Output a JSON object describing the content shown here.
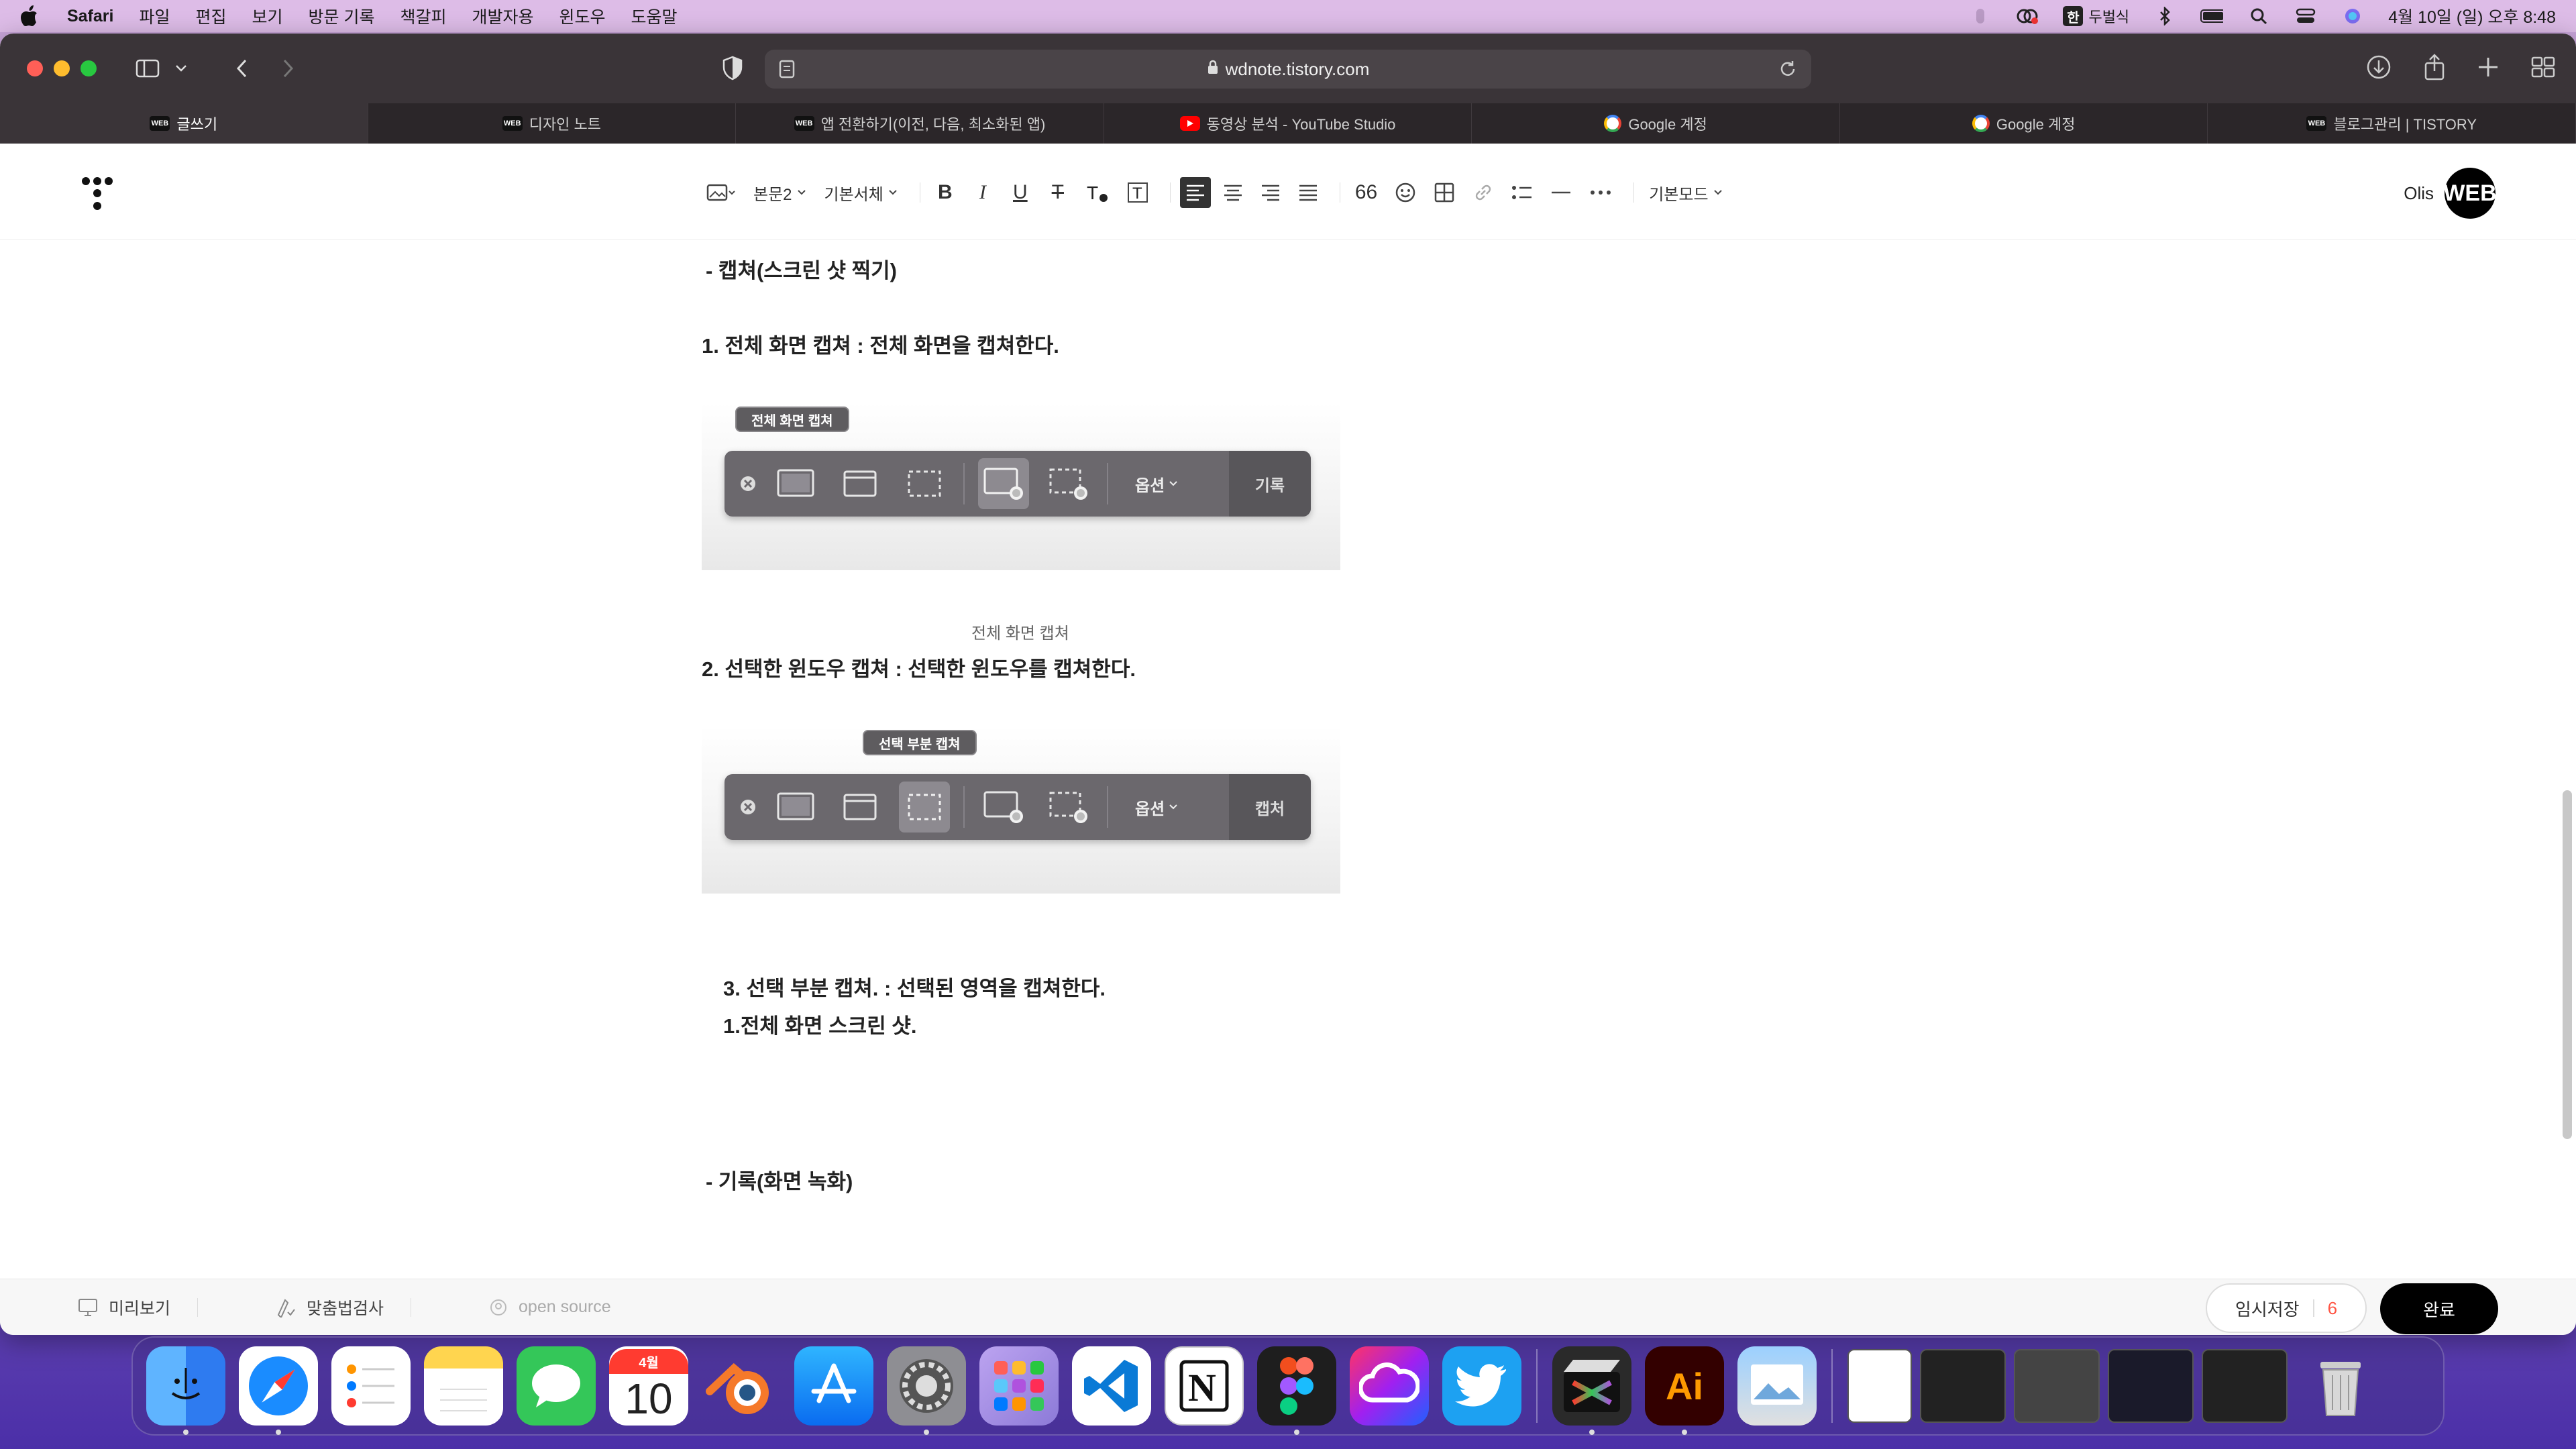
{
  "menubar": {
    "app_name": "Safari",
    "items": [
      "파일",
      "편집",
      "보기",
      "방문 기록",
      "책갈피",
      "개발자용",
      "윈도우",
      "도움말"
    ],
    "input_method": "두벌식",
    "ime_glyph": "한",
    "datetime": "4월 10일 (일) 오후 8:48"
  },
  "browser": {
    "address": "wdnote.tistory.com",
    "tabs": [
      {
        "label": "글쓰기",
        "icon": "web-favicon",
        "active": true
      },
      {
        "label": "디자인 노트",
        "icon": "web-favicon",
        "active": false
      },
      {
        "label": "앱 전환하기(이전, 다음, 최소화된 앱)",
        "icon": "web-favicon",
        "active": false
      },
      {
        "label": "동영상 분석 - YouTube Studio",
        "icon": "youtube-favicon",
        "active": false
      },
      {
        "label": "Google 계정",
        "icon": "google-favicon",
        "active": false
      },
      {
        "label": "Google 계정",
        "icon": "google-favicon",
        "active": false
      },
      {
        "label": "블로그관리 | TISTORY",
        "icon": "web-favicon",
        "active": false
      }
    ],
    "favicon_text": "WEB"
  },
  "editor": {
    "toolbar": {
      "paragraph_style": "본문2",
      "font": "기본서체",
      "quote_glyph": "66",
      "mode": "기본모드"
    },
    "user": {
      "name": "Olis",
      "avatar_text": "WEB"
    }
  },
  "content": {
    "heading_capture": "- 캡쳐(스크린 샷 찍기)",
    "item1": "1. 전체 화면 캡쳐 : 전체 화면을 캡쳐한다.",
    "shot1": {
      "tooltip": "전체 화면 캡쳐",
      "option": "옵션",
      "action": "기록",
      "caption": "전체 화면 캡쳐"
    },
    "item2": "2. 선택한 윈도우 캡쳐 : 선택한 윈도우를 캡쳐한다.",
    "shot2": {
      "tooltip": "선택 부분 캡쳐",
      "option": "옵션",
      "action": "캡처"
    },
    "item3": "3. 선택 부분 캡쳐. : 선택된 영역을 캡쳐한다.",
    "item3_sub": "1.전체 화면 스크린 샷.",
    "heading_record": "- 기록(화면 녹화)"
  },
  "footer": {
    "preview": "미리보기",
    "spellcheck": "맞춤법검사",
    "open_source": "open source",
    "save_label": "임시저장",
    "save_count": "6",
    "done": "완료"
  },
  "dock": {
    "calendar_month": "4월",
    "calendar_day": "10",
    "illustrator": "Ai"
  },
  "colors": {
    "accent": "#000000",
    "save_count": "#ff5544",
    "menubar_bg": "#debee8",
    "browser_chrome": "#3a3438"
  }
}
